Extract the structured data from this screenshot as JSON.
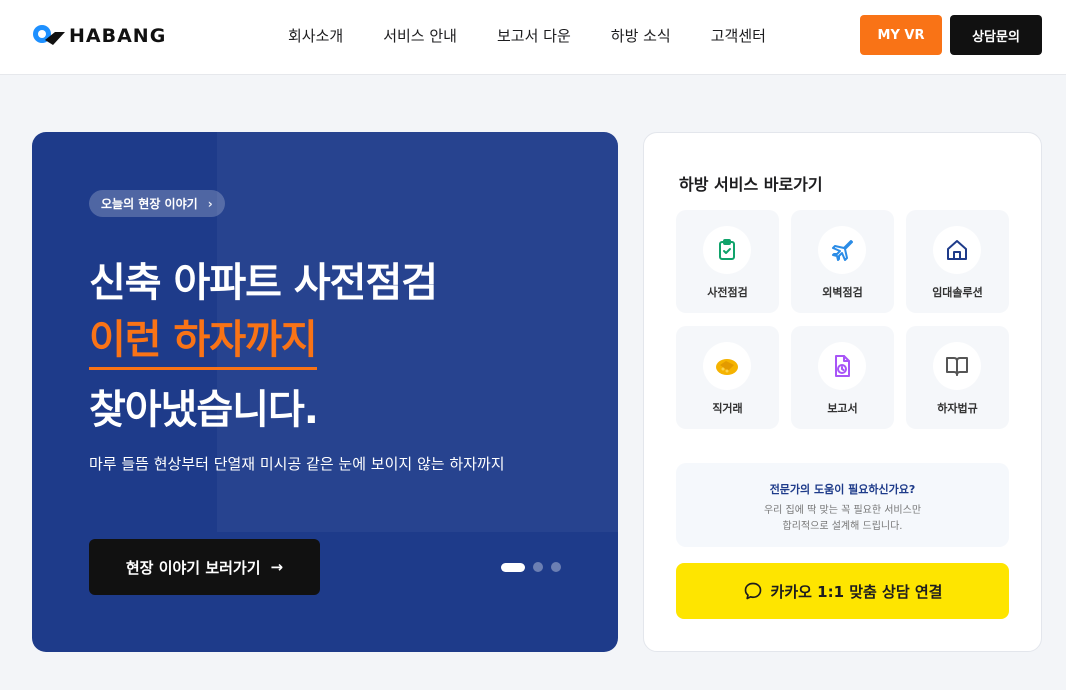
{
  "brand": {
    "name": "HABANG"
  },
  "nav": {
    "items": [
      "회사소개",
      "서비스 안내",
      "보고서 다운",
      "하방 소식",
      "고객센터"
    ],
    "my_vr": "MY VR",
    "consult": "상담문의"
  },
  "hero": {
    "pill": "오늘의 현장 이야기",
    "line1": "신축 아파트 사전점검",
    "line2": "이런 하자까지",
    "line3": "찾아냈습니다.",
    "desc": "마루 들뜸 현상부터 단열재 미시공 같은 눈에 보이지 않는 하자까지",
    "cta": "현장 이야기 보러가기",
    "slides": {
      "count": 3,
      "active": 1
    }
  },
  "services": {
    "title": "하방 서비스 바로가기",
    "tiles": [
      {
        "label": "사전점검",
        "icon": "clipboard-check-icon",
        "color": "#10a36b"
      },
      {
        "label": "외벽점검",
        "icon": "airplane-icon",
        "color": "#2b8ce6"
      },
      {
        "label": "임대솔루션",
        "icon": "home-icon",
        "color": "#1e3b8a"
      },
      {
        "label": "직거래",
        "icon": "handshake-icon",
        "color": "#f5b301"
      },
      {
        "label": "보고서",
        "icon": "document-clock-icon",
        "color": "#a855f7"
      },
      {
        "label": "하자법규",
        "icon": "book-open-icon",
        "color": "#555555"
      }
    ],
    "help_title": "전문가의 도움이 필요하신가요?",
    "help_desc1": "우리 집에 딱 맞는 꼭 필요한 서비스만",
    "help_desc2": "합리적으로 설계해 드립니다.",
    "kakao": "카카오 1:1 맞춤 상담 연결"
  },
  "colors": {
    "accent": "#f97316",
    "hero_bg": "#1e3b8a",
    "kakao": "#fee500"
  }
}
